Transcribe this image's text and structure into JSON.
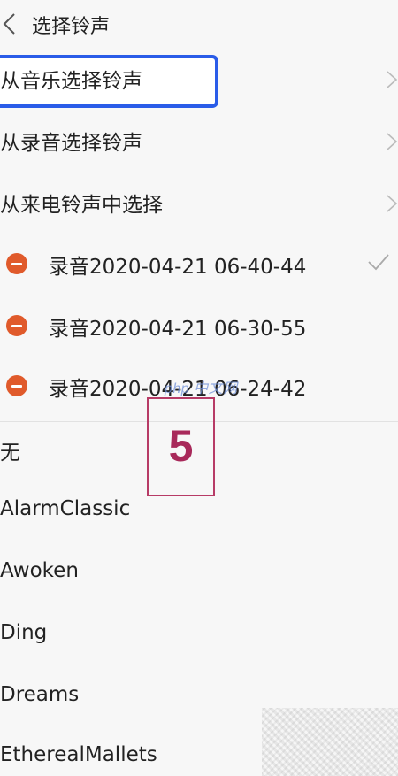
{
  "header": {
    "title": "选择铃声",
    "back_icon": "chevron-left-icon"
  },
  "sources": [
    {
      "label": "从音乐选择铃声"
    },
    {
      "label": "从录音选择铃声"
    },
    {
      "label": "从来电铃声中选择"
    }
  ],
  "recordings": [
    {
      "label": "录音2020-04-21  06-40-44",
      "selected": true
    },
    {
      "label": "录音2020-04-21  06-30-55",
      "selected": false
    },
    {
      "label": "录音2020-04-21  06-24-42",
      "selected": false
    }
  ],
  "ringtones": [
    {
      "label": "无"
    },
    {
      "label": "AlarmClassic"
    },
    {
      "label": "Awoken"
    },
    {
      "label": "Ding"
    },
    {
      "label": "Dreams"
    },
    {
      "label": "EtherealMallets"
    }
  ],
  "annotation": {
    "number": "5"
  },
  "watermark": {
    "text": "php 中文网"
  },
  "colors": {
    "highlight_border": "#2a5ce8",
    "delete_icon": "#e05a2b",
    "annotation": "#a8295a",
    "background": "#f7f7f7"
  }
}
